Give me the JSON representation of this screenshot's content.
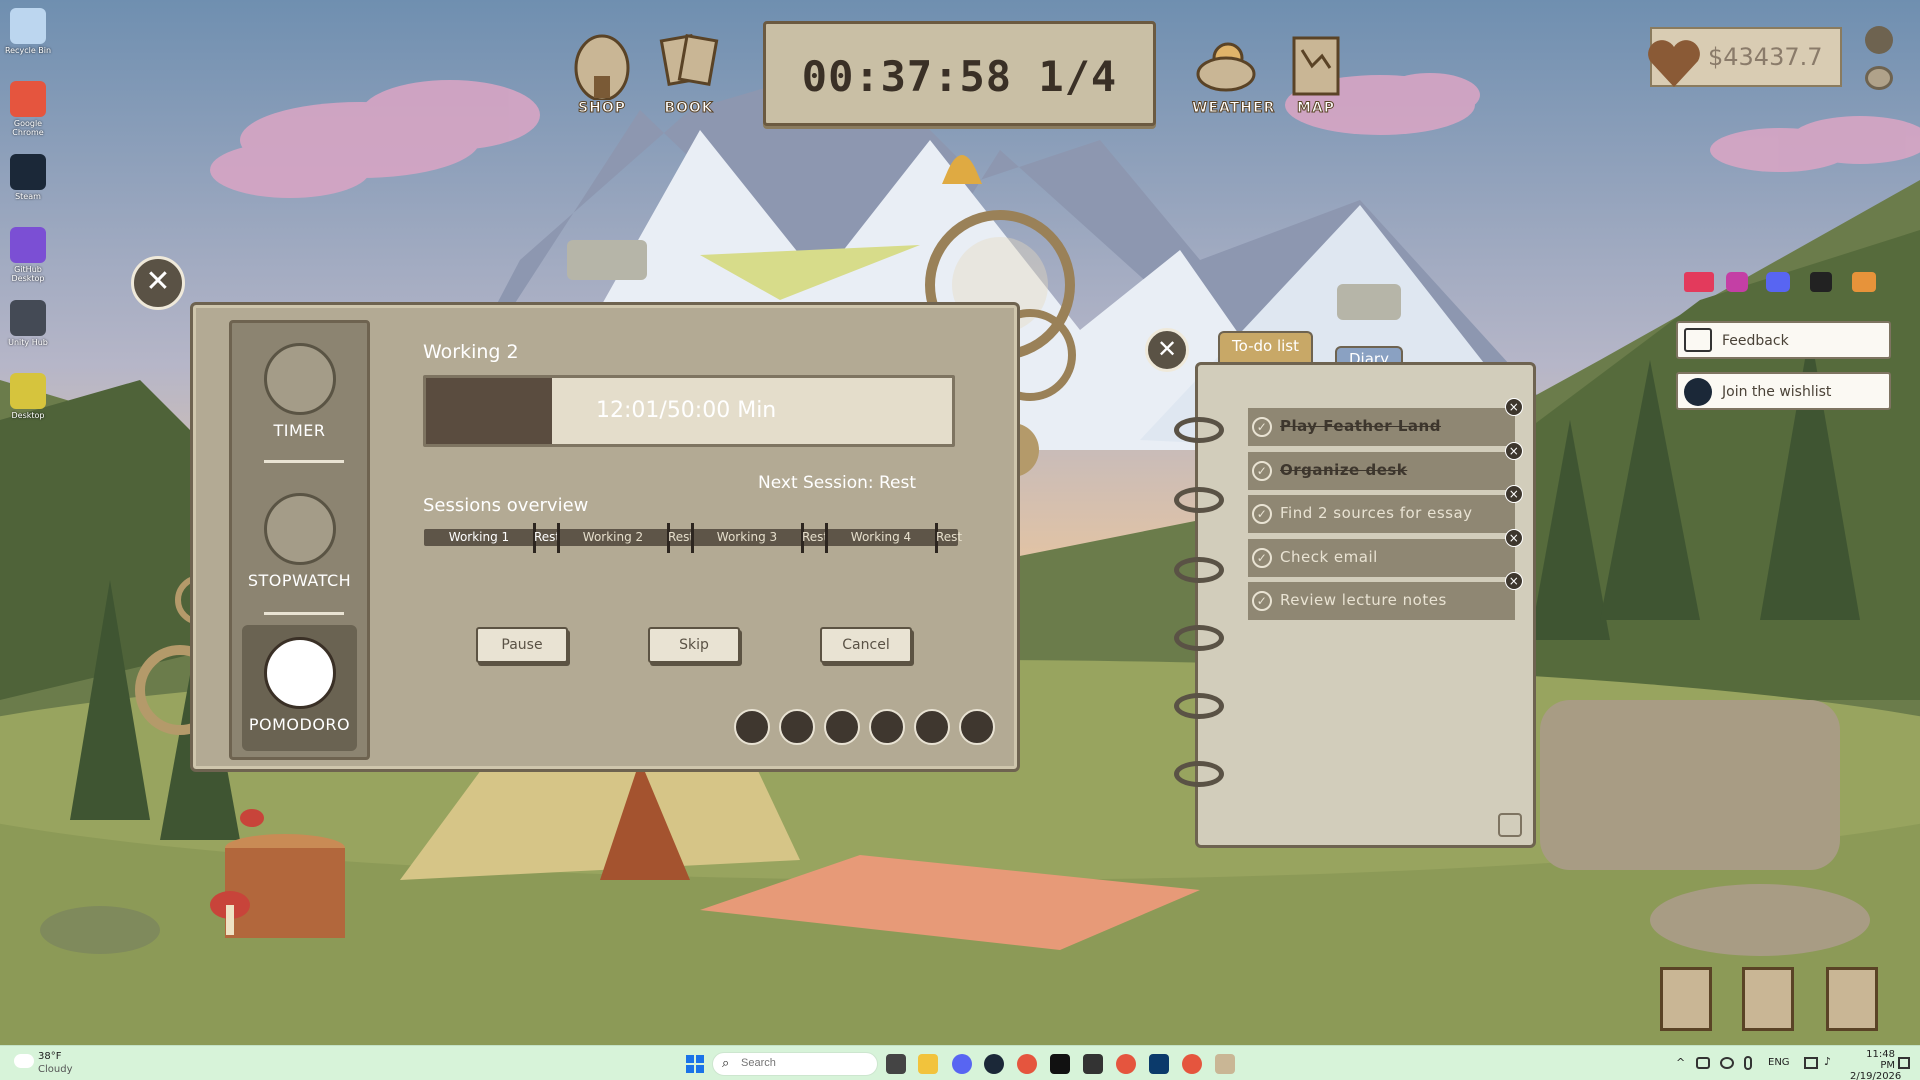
{
  "desktop_icons": [
    {
      "label": "Recycle Bin",
      "color": "#bcd6ef"
    },
    {
      "label": "Google Chrome",
      "color": "#e5553e"
    },
    {
      "label": "Steam",
      "color": "#1b2838"
    },
    {
      "label": "GitHub Desktop",
      "color": "#7b4fd4"
    },
    {
      "label": "Unity Hub",
      "color": "#444a55"
    },
    {
      "label": "Desktop",
      "color": "#d6c43d"
    }
  ],
  "top_nav": {
    "shop_label": "SHOP",
    "book_label": "BOOK",
    "weather_label": "WEATHER",
    "map_label": "MAP",
    "timer_display": "00:37:58  1/4"
  },
  "money": {
    "value": "$43437.7"
  },
  "pomodoro": {
    "modes": {
      "timer": "TIMER",
      "stopwatch": "STOPWATCH",
      "pomodoro": "POMODORO"
    },
    "session_name": "Working 2",
    "progress_text": "12:01/50:00 Min",
    "progress_fraction": 0.24,
    "next_session": "Next Session: Rest",
    "overview_title": "Sessions overview",
    "segments": [
      {
        "label": "Working 1",
        "state": "done"
      },
      {
        "label": "Rest",
        "state": "done"
      },
      {
        "label": "Working 2",
        "state": "current"
      },
      {
        "label": "Rest",
        "state": "todo"
      },
      {
        "label": "Working 3",
        "state": "todo"
      },
      {
        "label": "Rest",
        "state": "todo"
      },
      {
        "label": "Working 4",
        "state": "todo"
      },
      {
        "label": "Rest",
        "state": "todo"
      }
    ],
    "buttons": {
      "pause": "Pause",
      "skip": "Skip",
      "cancel": "Cancel"
    },
    "sound_icons": [
      "flute-icon",
      "guitar-icon",
      "campfire-icon",
      "mushroom-icon",
      "moon-icon",
      "cricket-icon"
    ]
  },
  "todo": {
    "tabs": {
      "todo": "To-do list",
      "diary": "Diary"
    },
    "items": [
      {
        "text": "Play Feather Land",
        "done": true
      },
      {
        "text": "Organize desk",
        "done": true
      },
      {
        "text": "Find 2 sources for essay",
        "done": false
      },
      {
        "text": "Check email",
        "done": false
      },
      {
        "text": "Review lecture notes",
        "done": false
      }
    ]
  },
  "side_links": {
    "feedback": "Feedback",
    "wishlist": "Join the wishlist"
  },
  "taskbar": {
    "weather_temp": "38°F",
    "weather_desc": "Cloudy",
    "search_placeholder": "Search",
    "lang": "ENG",
    "time": "11:48 PM",
    "date": "2/19/2026"
  },
  "colors": {
    "panel": "#b3aa94",
    "panel_dark": "#8c8471",
    "accent_dark": "#5a4c3f",
    "taskbar": "#d7f3d9"
  }
}
